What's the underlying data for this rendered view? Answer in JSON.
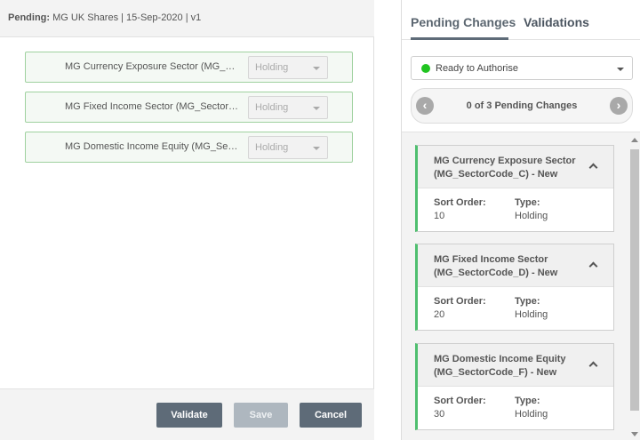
{
  "header": {
    "label": "Pending:",
    "text": "MG UK Shares | 15-Sep-2020 | v1"
  },
  "rows": [
    {
      "name": "MG Currency Exposure Sector (MG_SectorCode_C)",
      "value": "Holding"
    },
    {
      "name": "MG Fixed Income Sector (MG_SectorCode_D)",
      "value": "Holding"
    },
    {
      "name": "MG Domestic Income Equity (MG_SectorCode_F)",
      "value": "Holding"
    }
  ],
  "footer": {
    "validate": "Validate",
    "save": "Save",
    "cancel": "Cancel"
  },
  "tabs": {
    "pending": "Pending Changes",
    "validations": "Validations"
  },
  "status": {
    "label": "Ready to Authorise",
    "color": "#21c421"
  },
  "nav": {
    "text": "0 of 3 Pending Changes",
    "prev_icon": "chevron-left-icon",
    "next_icon": "chevron-right-icon"
  },
  "cards": [
    {
      "title": "MG Currency Exposure Sector (MG_SectorCode_C) - New",
      "sort_label": "Sort Order:",
      "sort": "10",
      "type_label": "Type:",
      "type": "Holding"
    },
    {
      "title": "MG Fixed Income Sector (MG_SectorCode_D) - New",
      "sort_label": "Sort Order:",
      "sort": "20",
      "type_label": "Type:",
      "type": "Holding"
    },
    {
      "title": "MG Domestic Income Equity (MG_SectorCode_F) - New",
      "sort_label": "Sort Order:",
      "sort": "30",
      "type_label": "Type:",
      "type": "Holding"
    }
  ],
  "colors": {
    "accent": "#5e6b78",
    "card_border": "#4fbf6f"
  }
}
